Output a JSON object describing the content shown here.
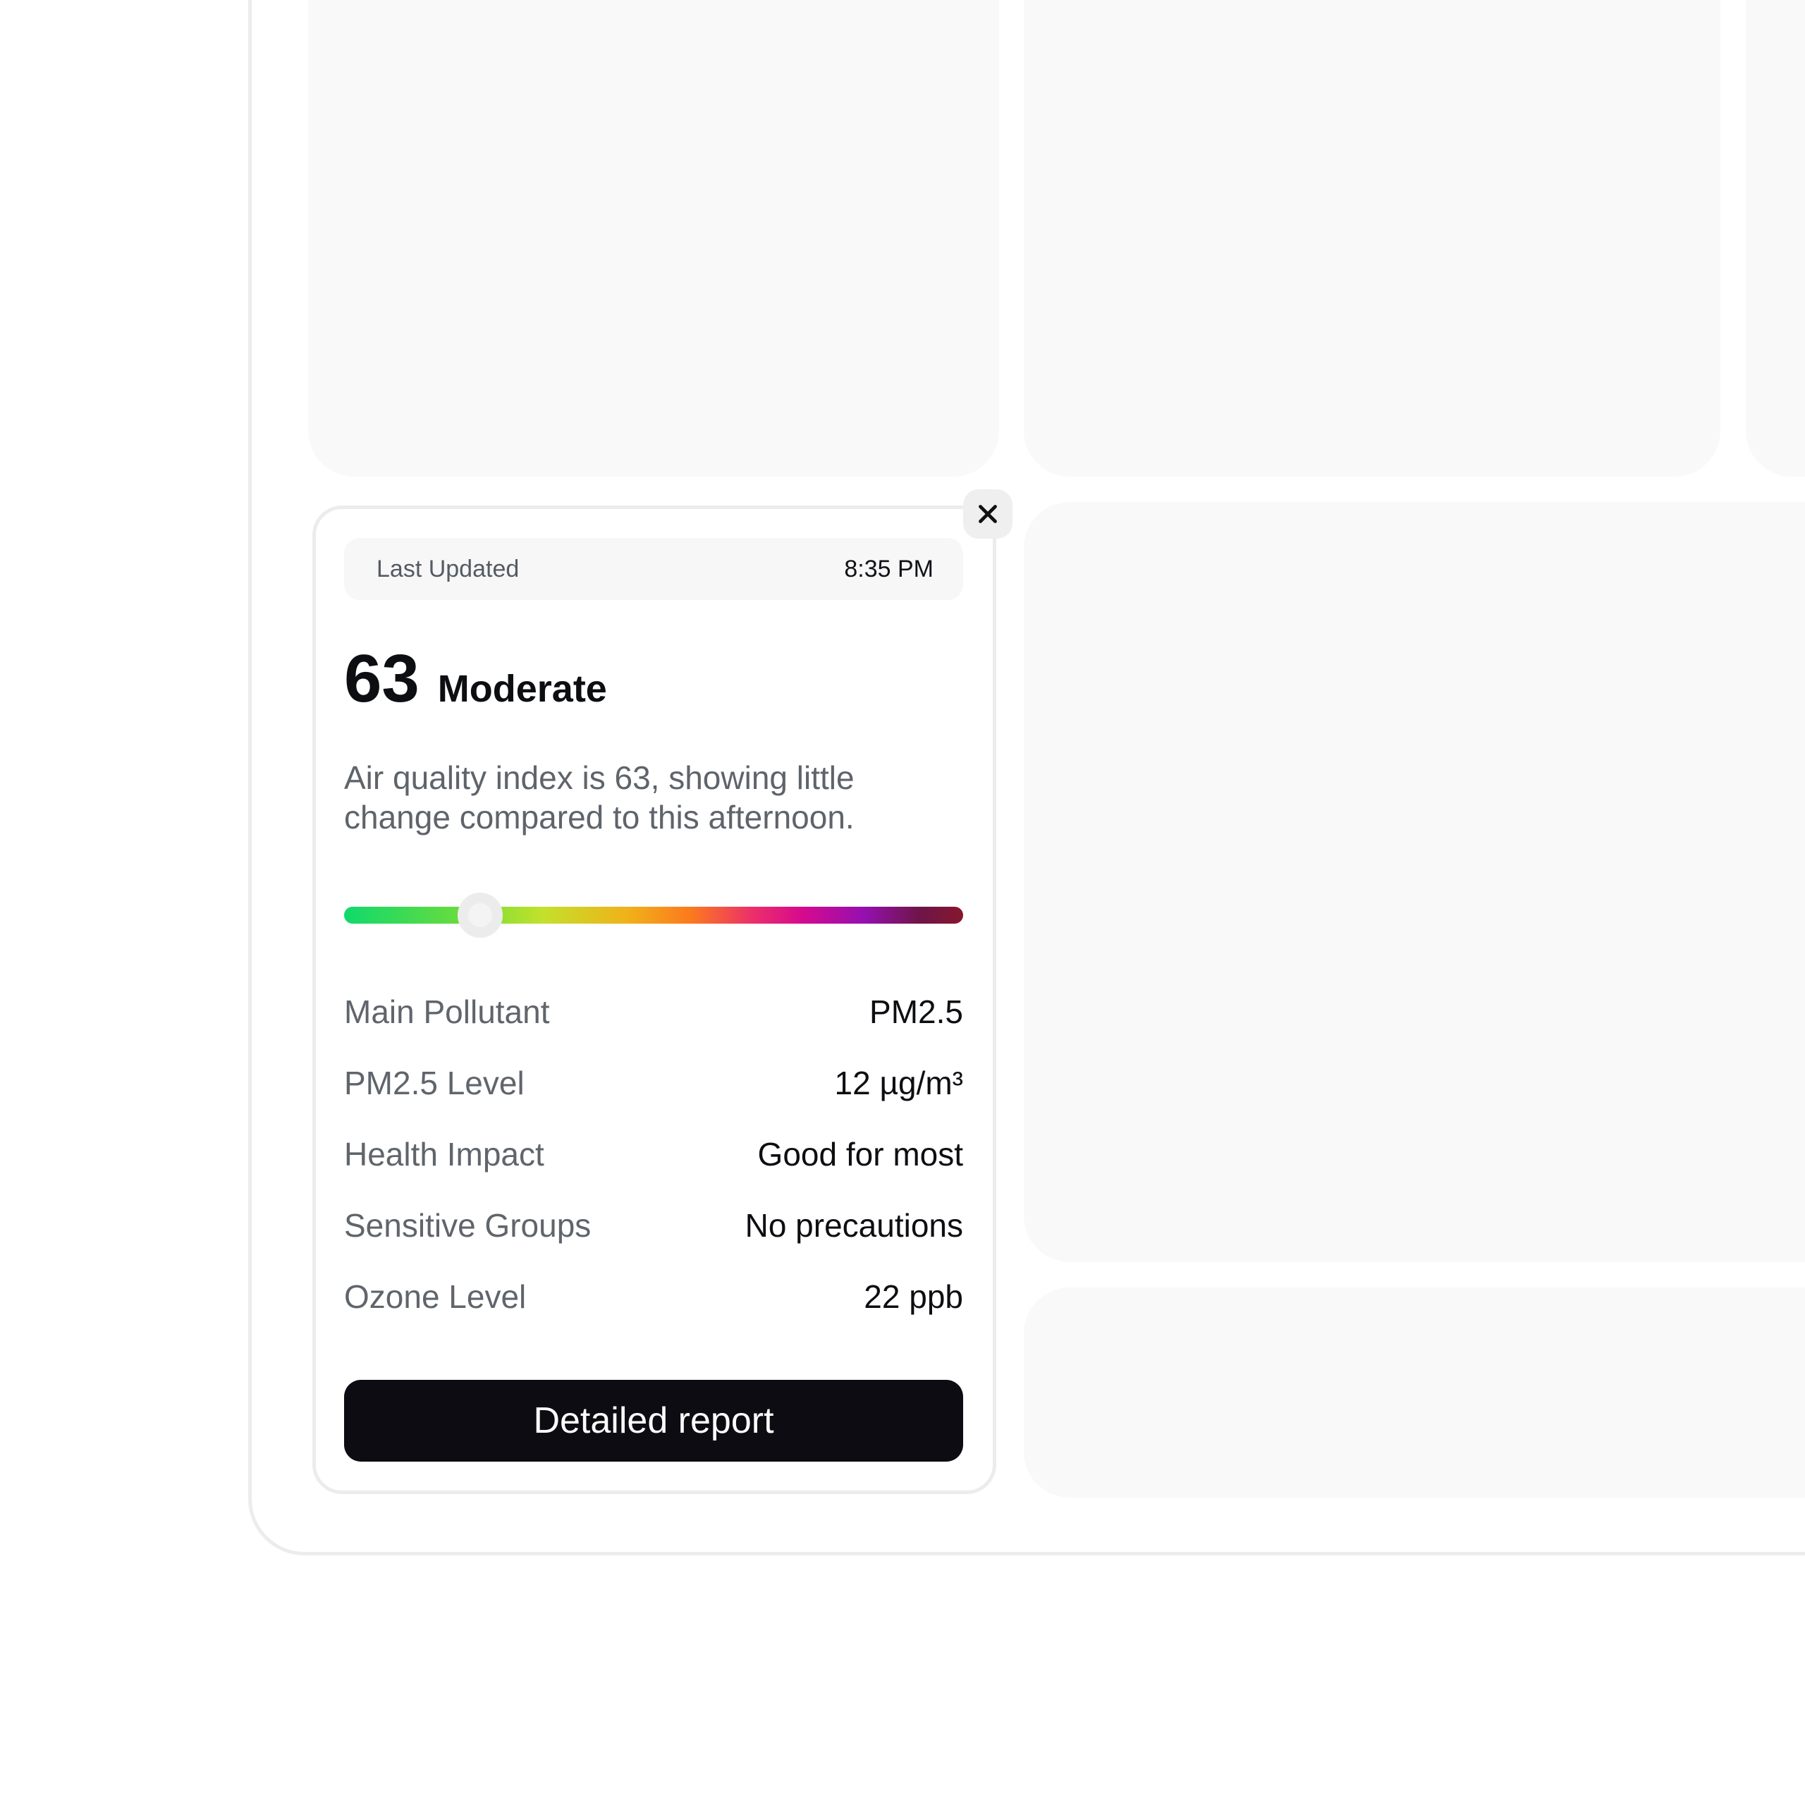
{
  "card": {
    "updated_label": "Last Updated",
    "updated_time": "8:35 PM",
    "aqi_value": "63",
    "aqi_category": "Moderate",
    "summary": "Air quality index is 63, showing little change compared to this afternoon.",
    "scale": {
      "min": 0,
      "max": 500,
      "value": 63,
      "position_fraction": 0.22
    },
    "stats": [
      {
        "label": "Main Pollutant",
        "value": "PM2.5"
      },
      {
        "label": "PM2.5 Level",
        "value": "12 µg/m³"
      },
      {
        "label": "Health Impact",
        "value": "Good for most"
      },
      {
        "label": "Sensitive Groups",
        "value": "No precautions"
      },
      {
        "label": "Ozone Level",
        "value": "22 ppb"
      }
    ],
    "report_button_label": "Detailed report",
    "close_icon": "close-icon"
  },
  "colors": {
    "accent_button": "#0c0c12",
    "scale_start": "#10d96c",
    "scale_end": "#87162e",
    "tile_background": "#f9f9f9"
  }
}
